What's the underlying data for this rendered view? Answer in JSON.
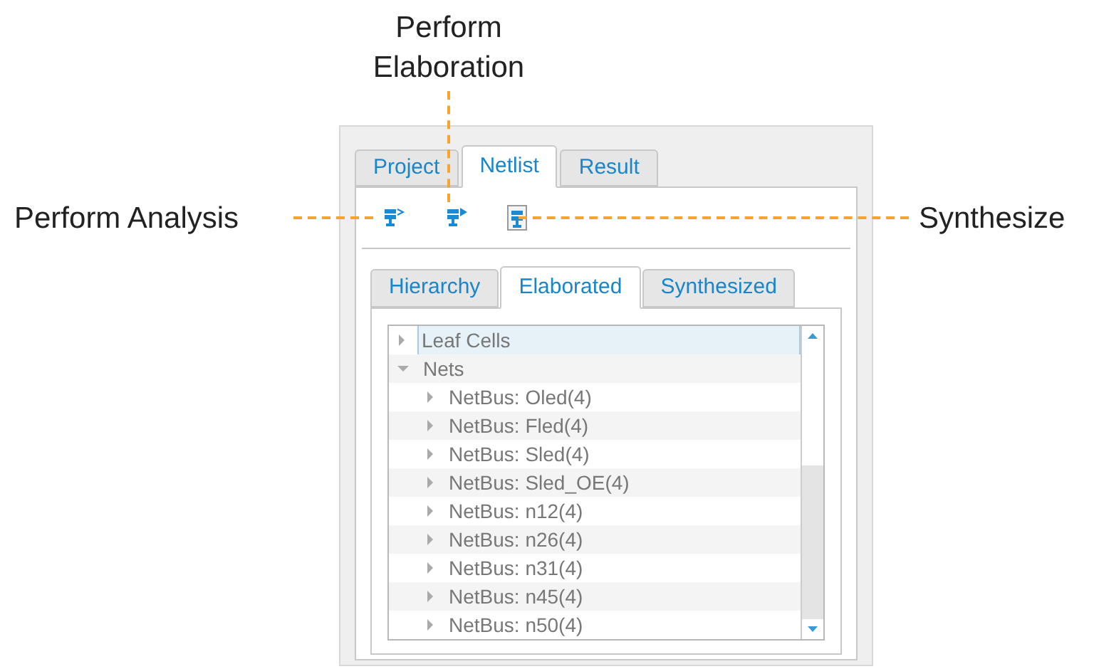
{
  "annotations": [
    {
      "kind": "left",
      "text": "Perform Analysis"
    },
    {
      "kind": "top",
      "text": "Perform\nElaboration"
    },
    {
      "kind": "right",
      "text": "Synthesize"
    }
  ],
  "tabs": [
    {
      "label": "Project",
      "selected": false
    },
    {
      "label": "Netlist",
      "selected": true
    },
    {
      "label": "Result",
      "selected": false
    }
  ],
  "toolbar": [
    {
      "kind": "analysis"
    },
    {
      "kind": "elaboration"
    },
    {
      "kind": "synthesize"
    }
  ],
  "subtabs": [
    {
      "label": "Hierarchy",
      "selected": false
    },
    {
      "label": "Elaborated",
      "selected": true
    },
    {
      "label": "Synthesized",
      "selected": false
    }
  ],
  "tree": [
    {
      "label": "Leaf Cells",
      "expanded": false,
      "selected": true
    },
    {
      "label": "Nets",
      "expanded": true,
      "selected": false,
      "children": [
        {
          "label": "NetBus: Oled(4)",
          "expanded": false,
          "selected": false
        },
        {
          "label": "NetBus: Fled(4)",
          "expanded": false,
          "selected": false
        },
        {
          "label": "NetBus: Sled(4)",
          "expanded": false,
          "selected": false
        },
        {
          "label": "NetBus: Sled_OE(4)",
          "expanded": false,
          "selected": false
        },
        {
          "label": "NetBus: n12(4)",
          "expanded": false,
          "selected": false
        },
        {
          "label": "NetBus: n26(4)",
          "expanded": false,
          "selected": false
        },
        {
          "label": "NetBus: n31(4)",
          "expanded": false,
          "selected": false
        },
        {
          "label": "NetBus: n45(4)",
          "expanded": false,
          "selected": false
        },
        {
          "label": "NetBus: n50(4)",
          "expanded": false,
          "selected": false
        }
      ]
    }
  ]
}
